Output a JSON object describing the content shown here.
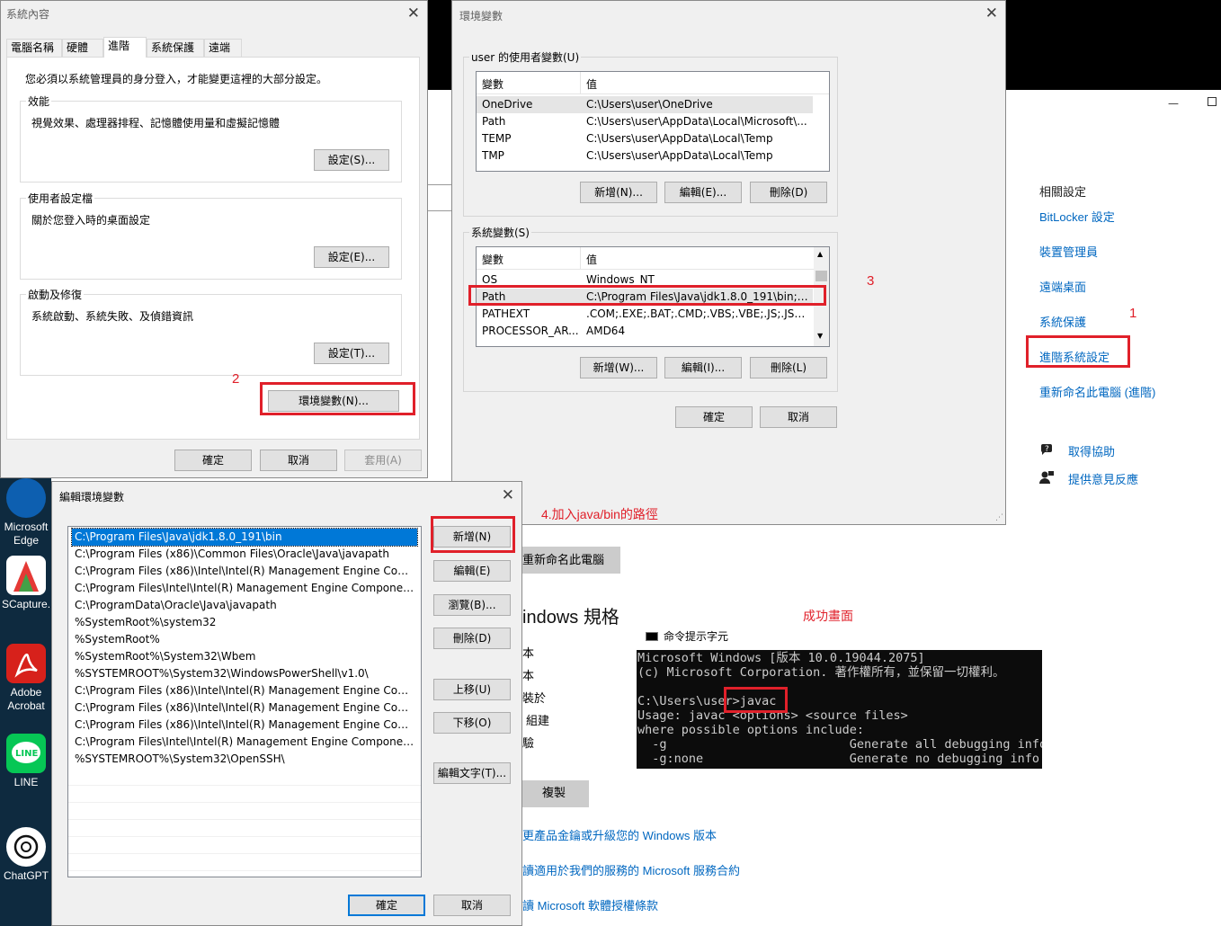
{
  "sys_props": {
    "title": "系統內容",
    "tabs": [
      "電腦名稱",
      "硬體",
      "進階",
      "系統保護",
      "遠端"
    ],
    "admin_note": "您必須以系統管理員的身分登入，才能變更這裡的大部分設定。",
    "perf": {
      "label": "效能",
      "desc": "視覺效果、處理器排程、記憶體使用量和虛擬記憶體",
      "button": "設定(S)..."
    },
    "profile": {
      "label": "使用者設定檔",
      "desc": "關於您登入時的桌面設定",
      "button": "設定(E)..."
    },
    "startup": {
      "label": "啟動及修復",
      "desc": "系統啟動、系統失敗、及偵錯資訊",
      "button": "設定(T)..."
    },
    "env_button": "環境變數(N)...",
    "ok": "確定",
    "cancel": "取消",
    "apply": "套用(A)"
  },
  "env_vars": {
    "title": "環境變數",
    "user_group": "user 的使用者變數(U)",
    "col_var": "變數",
    "col_val": "值",
    "user_rows": [
      {
        "name": "OneDrive",
        "value": "C:\\Users\\user\\OneDrive"
      },
      {
        "name": "Path",
        "value": "C:\\Users\\user\\AppData\\Local\\Microsoft\\..."
      },
      {
        "name": "TEMP",
        "value": "C:\\Users\\user\\AppData\\Local\\Temp"
      },
      {
        "name": "TMP",
        "value": "C:\\Users\\user\\AppData\\Local\\Temp"
      }
    ],
    "user_buttons": [
      "新增(N)...",
      "編輯(E)...",
      "刪除(D)"
    ],
    "sys_group": "系統變數(S)",
    "sys_rows": [
      {
        "name": "OS",
        "value": "Windows_NT"
      },
      {
        "name": "Path",
        "value": "C:\\Program Files\\Java\\jdk1.8.0_191\\bin;C:..."
      },
      {
        "name": "PATHEXT",
        "value": ".COM;.EXE;.BAT;.CMD;.VBS;.VBE;.JS;.JSE;..."
      },
      {
        "name": "PROCESSOR_AR...",
        "value": "AMD64"
      }
    ],
    "sys_buttons": [
      "新增(W)...",
      "編輯(I)...",
      "刪除(L)"
    ],
    "ok": "確定",
    "cancel": "取消"
  },
  "edit_env": {
    "title": "編輯環境變數",
    "entries": [
      "C:\\Program Files\\Java\\jdk1.8.0_191\\bin",
      "C:\\Program Files (x86)\\Common Files\\Oracle\\Java\\javapath",
      "C:\\Program Files (x86)\\Intel\\Intel(R) Management Engine Compo...",
      "C:\\Program Files\\Intel\\Intel(R) Management Engine Components\\...",
      "C:\\ProgramData\\Oracle\\Java\\javapath",
      "%SystemRoot%\\system32",
      "%SystemRoot%",
      "%SystemRoot%\\System32\\Wbem",
      "%SYSTEMROOT%\\System32\\WindowsPowerShell\\v1.0\\",
      "C:\\Program Files (x86)\\Intel\\Intel(R) Management Engine Compo...",
      "C:\\Program Files (x86)\\Intel\\Intel(R) Management Engine Components\\...",
      "C:\\Program Files (x86)\\Intel\\Intel(R) Management Engine Compo...",
      "C:\\Program Files\\Intel\\Intel(R) Management Engine Components\\...",
      "%SYSTEMROOT%\\System32\\OpenSSH\\"
    ],
    "buttons": {
      "new": "新增(N)",
      "edit": "編輯(E)",
      "browse": "瀏覽(B)...",
      "delete": "刪除(D)",
      "up": "上移(U)",
      "down": "下移(O)",
      "edit_text": "編輯文字(T)..."
    },
    "ok": "確定",
    "cancel": "取消"
  },
  "settings_page": {
    "related_title": "相關設定",
    "links": [
      "BitLocker 設定",
      "裝置管理員",
      "遠端桌面",
      "系統保護",
      "進階系統設定",
      "重新命名此電腦 (進階)"
    ],
    "help": "取得協助",
    "feedback": "提供意見反應",
    "rename_button": "重新命名此電腦",
    "spec_title": "indows 規格",
    "spec_labels": [
      "本",
      "本",
      "裝於",
      "組建",
      "驗"
    ],
    "copy_button": "複製",
    "bottom_links": [
      "更產品金鑰或升級您的 Windows 版本",
      "讀適用於我們的服務的 Microsoft 服務合約",
      "讀 Microsoft 軟體授權條款"
    ]
  },
  "desktop_icons": [
    "Microsoft Edge",
    "SCapture...",
    "Adobe Acrobat",
    "LINE",
    "ChatGPT"
  ],
  "annotations": {
    "n1": "1",
    "n2": "2",
    "n3": "3",
    "step4": "4.加入java/bin的路徑",
    "success": "成功畫面"
  },
  "cmd": {
    "title": "命令提示字元",
    "lines": [
      "Microsoft Windows [版本 10.0.19044.2075]",
      "(c) Microsoft Corporation. 著作權所有，並保留一切權利。",
      "",
      "C:\\Users\\user>javac",
      "Usage: javac <options> <source files>",
      "where possible options include:",
      "  -g                         Generate all debugging info",
      "  -g:none                    Generate no debugging info"
    ]
  },
  "colors": {
    "annotation_red": "#e0202a",
    "link_blue": "#0067c0",
    "selection_blue": "#0078d7"
  }
}
